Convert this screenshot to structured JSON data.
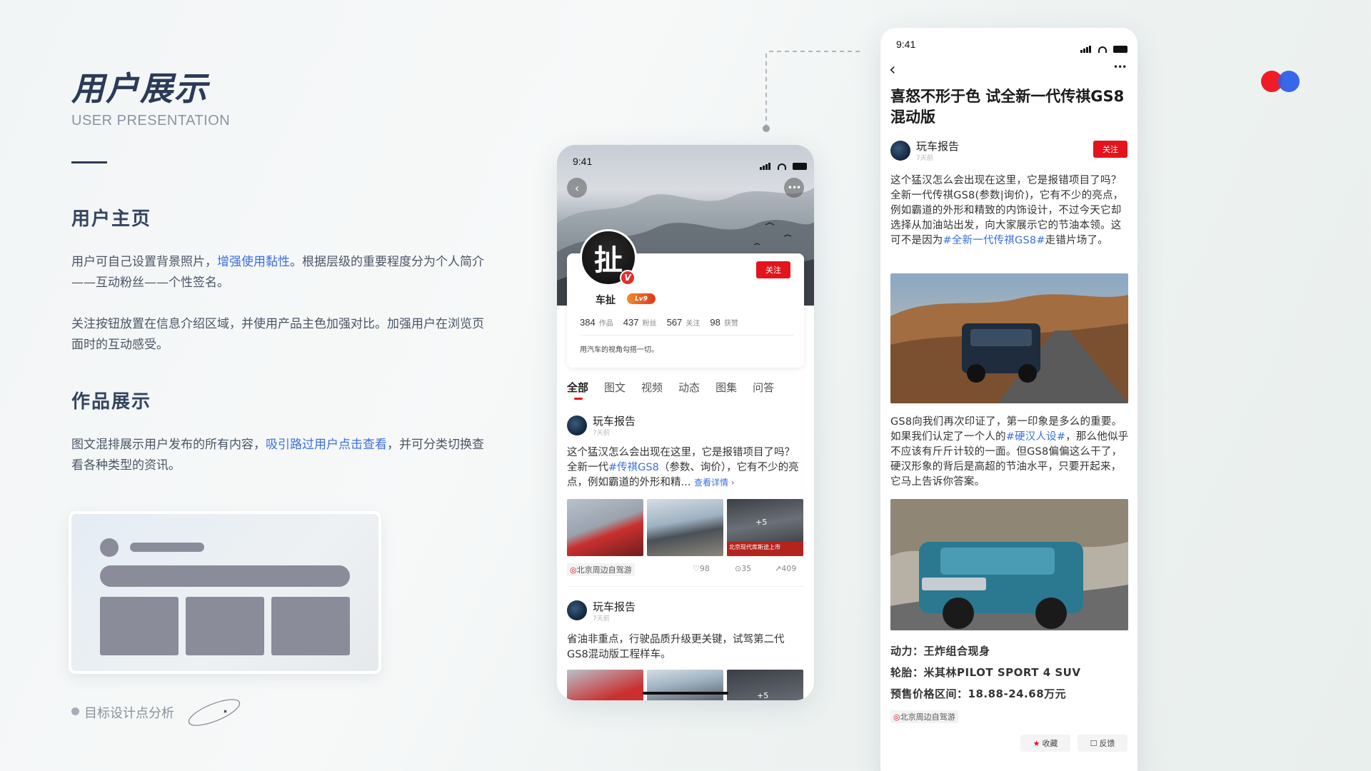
{
  "page": {
    "title": "用户展示",
    "subtitle": "USER PRESENTATION",
    "sections": [
      {
        "title": "用户主页",
        "p1_pre": "用户可自己设置背景照片，",
        "p1_hl": "增强使用黏性",
        "p1_post": "。根据层级的重要程度分为个人简介——互动粉丝——个性签名。",
        "p2": "关注按钮放置在信息介绍区域，并使用产品主色加强对比。加强用户在浏览页面时的互动感受。"
      },
      {
        "title": "作品展示",
        "p1_pre": "图文混排展示用户发布的所有内容，",
        "p1_hl": "吸引路过用户点击查看",
        "p1_post": "，并可分类切换查看各种类型的资讯。"
      }
    ],
    "legend": "目标设计点分析"
  },
  "colors": {
    "accent": "#e3141c",
    "link": "#3b6fe0",
    "brand_red": "#ef1c26",
    "brand_blue": "#2f5fe8",
    "title_navy": "#2b3a56"
  },
  "profile_phone": {
    "time": "9:41",
    "back_icon": "chevron-left-icon",
    "more_icon": "ellipsis-icon",
    "avatar_char": "扯",
    "verified": "V",
    "follow": "关注",
    "username": "车扯",
    "level": "Lv9",
    "stats": [
      {
        "num": "384",
        "label": "作品"
      },
      {
        "num": "437",
        "label": "粉丝"
      },
      {
        "num": "567",
        "label": "关注"
      },
      {
        "num": "98",
        "label": "获赞"
      }
    ],
    "bio": "用汽车的视角勾搭一切。",
    "tabs": [
      "全部",
      "图文",
      "视频",
      "动态",
      "图集",
      "问答"
    ],
    "posts": [
      {
        "user": "玩车报告",
        "time": "7天前",
        "text_a": "这个猛汉怎么会出现在这里，它是报错项目了吗？全新一代",
        "text_link": "#传祺GS8",
        "text_b": "（参数、询价），它有不少的亮点，例如霸道的外形和精...",
        "more": "查看详情",
        "thumb3_badge": "+5",
        "thumb3_caption": "北京现代库斯途上市",
        "location": "北京周边自驾游",
        "likes": "98",
        "comments": "35",
        "shares": "409"
      },
      {
        "user": "玩车报告",
        "time": "7天前",
        "text": "省油非重点，行驶品质升级更关键，试驾第二代GS8混动版工程样车。",
        "thumb3_badge": "+5"
      }
    ]
  },
  "article_phone": {
    "time": "9:41",
    "title": "喜怒不形于色 试全新一代传祺GS8混动版",
    "author": "玩车报告",
    "author_time": "7天前",
    "follow": "关注",
    "para1_a": "这个猛汉怎么会出现在这里，它是报错项目了吗？全新一代传祺GS8(参数|询价)，它有不少的亮点，例如霸道的外形和精致的内饰设计，不过今天它却选择从加油站出发，向大家展示它的节油本领。这可不是因为",
    "para1_link": "#全新一代传祺GS8#",
    "para1_b": "走错片场了。",
    "para2_a": "GS8向我们再次印证了，第一印象是多么的重要。如果我们认定了一个人的",
    "para2_link": "#硬汉人设#",
    "para2_b": "，那么他似乎不应该有斤斤计较的一面。但GS8偏偏这么干了，硬汉形象的背后是高超的节油水平，只要开起来，它马上告诉你答案。",
    "specs": [
      {
        "label": "动力：",
        "value": "王炸组合现身"
      },
      {
        "label": "轮胎：",
        "value": "米其林PILOT SPORT 4 SUV"
      },
      {
        "label": "预售价格区间：",
        "value": "18.88-24.68万元"
      }
    ],
    "location": "北京周边自驾游",
    "collect": "收藏",
    "feedback": "反馈"
  }
}
